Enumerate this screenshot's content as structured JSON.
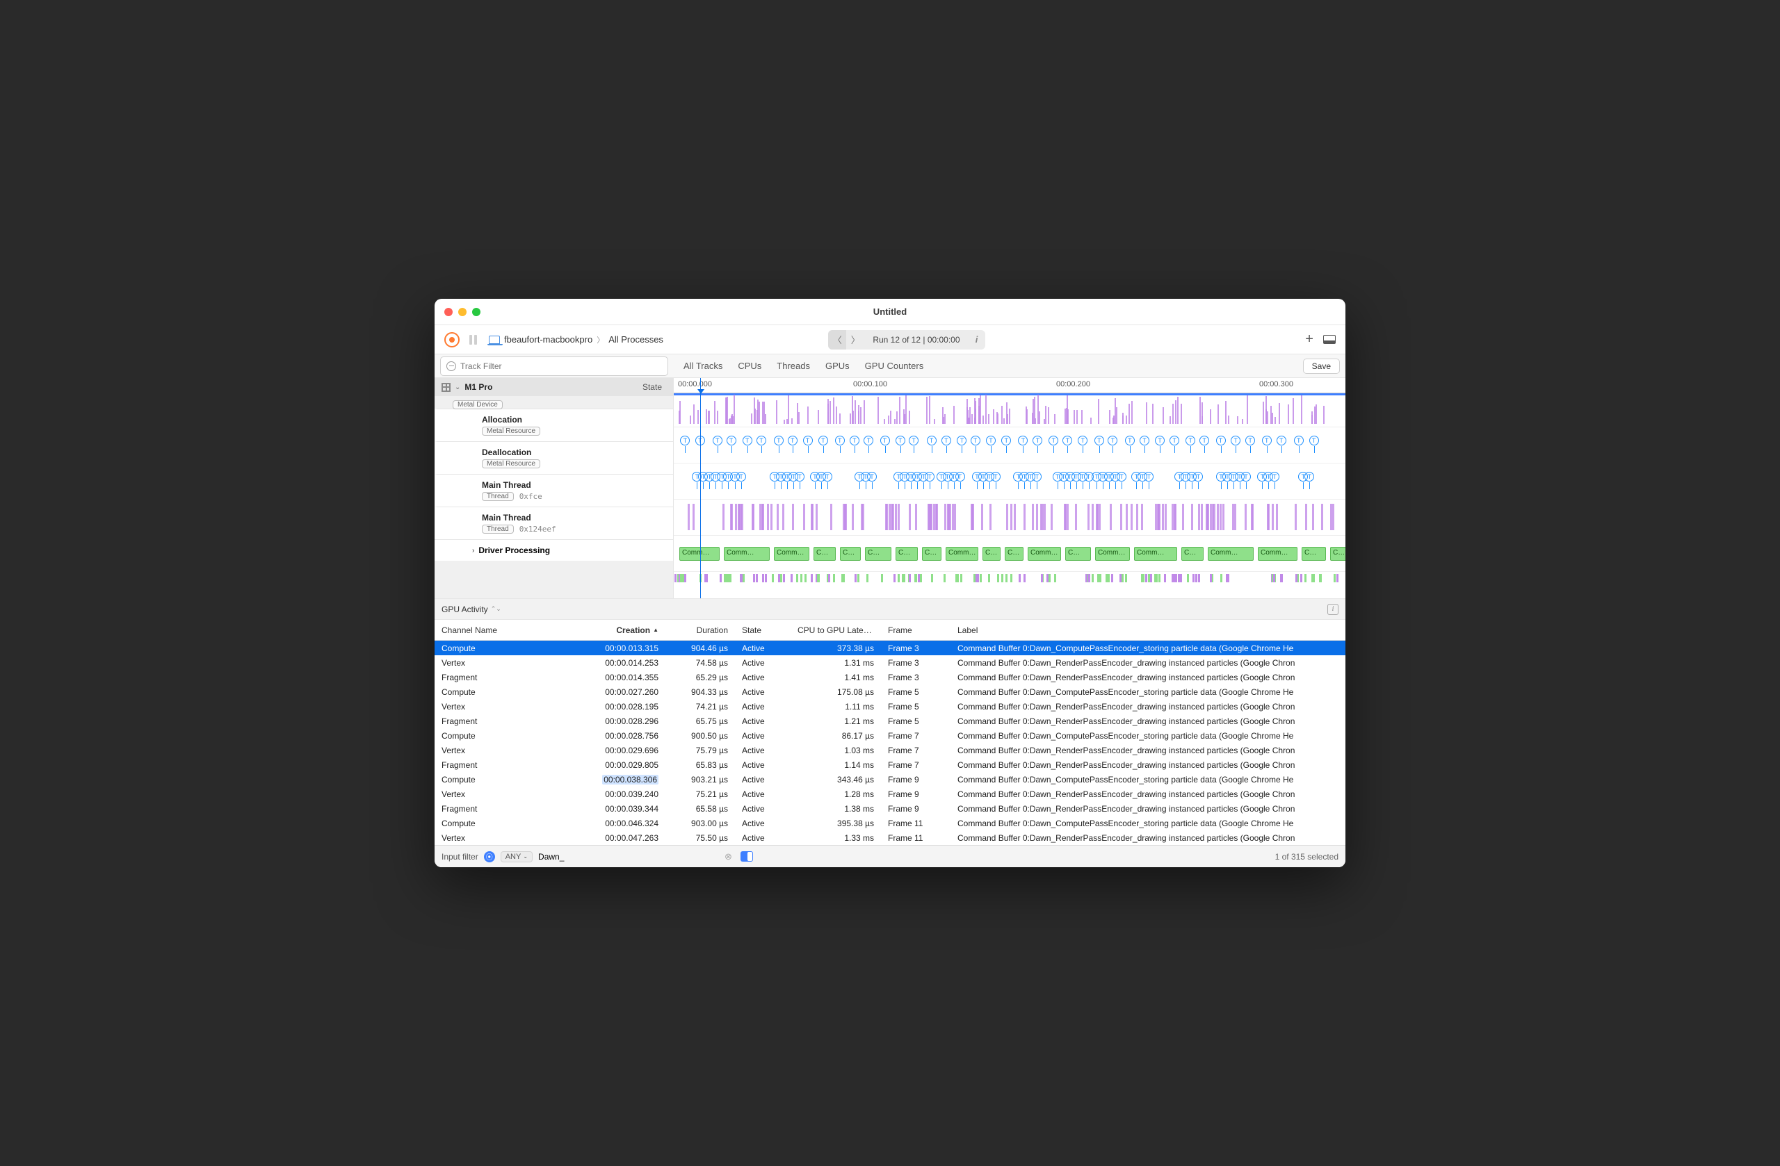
{
  "title": "Untitled",
  "toolbar": {
    "host": "fbeaufort-macbookpro",
    "scope": "All Processes",
    "run_info": "Run 12 of 12  |  00:00:00"
  },
  "filter": {
    "placeholder": "Track Filter",
    "tabs": [
      "All Tracks",
      "CPUs",
      "Threads",
      "GPUs",
      "GPU Counters"
    ],
    "save": "Save"
  },
  "ruler": {
    "t0": "00:00.000",
    "t1": "00:00.100",
    "t2": "00:00.200",
    "t3": "00:00.300"
  },
  "sidebar": {
    "device": "M1 Pro",
    "metal_device": "Metal Device",
    "state": "State",
    "tracks": [
      {
        "label": "Allocation",
        "tag": "Metal Resource"
      },
      {
        "label": "Deallocation",
        "tag": "Metal Resource"
      },
      {
        "label": "Main Thread",
        "tag": "Thread",
        "hex": "0xfce"
      },
      {
        "label": "Main Thread",
        "tag": "Thread",
        "hex": "0x124eef"
      }
    ],
    "driver": "Driver Processing"
  },
  "panel_selector": "GPU Activity",
  "columns": {
    "channel": "Channel Name",
    "creation": "Creation",
    "duration": "Duration",
    "state": "State",
    "latency": "CPU to GPU Laten…",
    "frame": "Frame",
    "label": "Label"
  },
  "rows": [
    {
      "channel": "Compute",
      "creation": "00:00.013.315",
      "duration": "904.46 µs",
      "state": "Active",
      "latency": "373.38 µs",
      "frame": "Frame 3",
      "label": "Command Buffer 0:Dawn_ComputePassEncoder_storing particle data   (Google Chrome He",
      "selected": true
    },
    {
      "channel": "Vertex",
      "creation": "00:00.014.253",
      "duration": "74.58 µs",
      "state": "Active",
      "latency": "1.31 ms",
      "frame": "Frame 3",
      "label": "Command Buffer 0:Dawn_RenderPassEncoder_drawing instanced particles   (Google Chron"
    },
    {
      "channel": "Fragment",
      "creation": "00:00.014.355",
      "duration": "65.29 µs",
      "state": "Active",
      "latency": "1.41 ms",
      "frame": "Frame 3",
      "label": "Command Buffer 0:Dawn_RenderPassEncoder_drawing instanced particles   (Google Chron"
    },
    {
      "channel": "Compute",
      "creation": "00:00.027.260",
      "duration": "904.33 µs",
      "state": "Active",
      "latency": "175.08 µs",
      "frame": "Frame 5",
      "label": "Command Buffer 0:Dawn_ComputePassEncoder_storing particle data   (Google Chrome He"
    },
    {
      "channel": "Vertex",
      "creation": "00:00.028.195",
      "duration": "74.21 µs",
      "state": "Active",
      "latency": "1.11 ms",
      "frame": "Frame 5",
      "label": "Command Buffer 0:Dawn_RenderPassEncoder_drawing instanced particles   (Google Chron"
    },
    {
      "channel": "Fragment",
      "creation": "00:00.028.296",
      "duration": "65.75 µs",
      "state": "Active",
      "latency": "1.21 ms",
      "frame": "Frame 5",
      "label": "Command Buffer 0:Dawn_RenderPassEncoder_drawing instanced particles   (Google Chron"
    },
    {
      "channel": "Compute",
      "creation": "00:00.028.756",
      "duration": "900.50 µs",
      "state": "Active",
      "latency": "86.17 µs",
      "frame": "Frame 7",
      "label": "Command Buffer 0:Dawn_ComputePassEncoder_storing particle data   (Google Chrome He"
    },
    {
      "channel": "Vertex",
      "creation": "00:00.029.696",
      "duration": "75.79 µs",
      "state": "Active",
      "latency": "1.03 ms",
      "frame": "Frame 7",
      "label": "Command Buffer 0:Dawn_RenderPassEncoder_drawing instanced particles   (Google Chron"
    },
    {
      "channel": "Fragment",
      "creation": "00:00.029.805",
      "duration": "65.83 µs",
      "state": "Active",
      "latency": "1.14 ms",
      "frame": "Frame 7",
      "label": "Command Buffer 0:Dawn_RenderPassEncoder_drawing instanced particles   (Google Chron"
    },
    {
      "channel": "Compute",
      "creation": "00:00.038.306",
      "duration": "903.21 µs",
      "state": "Active",
      "latency": "343.46 µs",
      "frame": "Frame 9",
      "label": "Command Buffer 0:Dawn_ComputePassEncoder_storing particle data   (Google Chrome He",
      "hl_creation": true
    },
    {
      "channel": "Vertex",
      "creation": "00:00.039.240",
      "duration": "75.21 µs",
      "state": "Active",
      "latency": "1.28 ms",
      "frame": "Frame 9",
      "label": "Command Buffer 0:Dawn_RenderPassEncoder_drawing instanced particles   (Google Chron"
    },
    {
      "channel": "Fragment",
      "creation": "00:00.039.344",
      "duration": "65.58 µs",
      "state": "Active",
      "latency": "1.38 ms",
      "frame": "Frame 9",
      "label": "Command Buffer 0:Dawn_RenderPassEncoder_drawing instanced particles   (Google Chron"
    },
    {
      "channel": "Compute",
      "creation": "00:00.046.324",
      "duration": "903.00 µs",
      "state": "Active",
      "latency": "395.38 µs",
      "frame": "Frame 11",
      "label": "Command Buffer 0:Dawn_ComputePassEncoder_storing particle data   (Google Chrome He"
    },
    {
      "channel": "Vertex",
      "creation": "00:00.047.263",
      "duration": "75.50 µs",
      "state": "Active",
      "latency": "1.33 ms",
      "frame": "Frame 11",
      "label": "Command Buffer 0:Dawn_RenderPassEncoder_drawing instanced particles   (Google Chron"
    }
  ],
  "footer": {
    "input_label": "Input filter",
    "any": "ANY",
    "filter_value": "Dawn_",
    "selection": "1 of 315 selected"
  }
}
